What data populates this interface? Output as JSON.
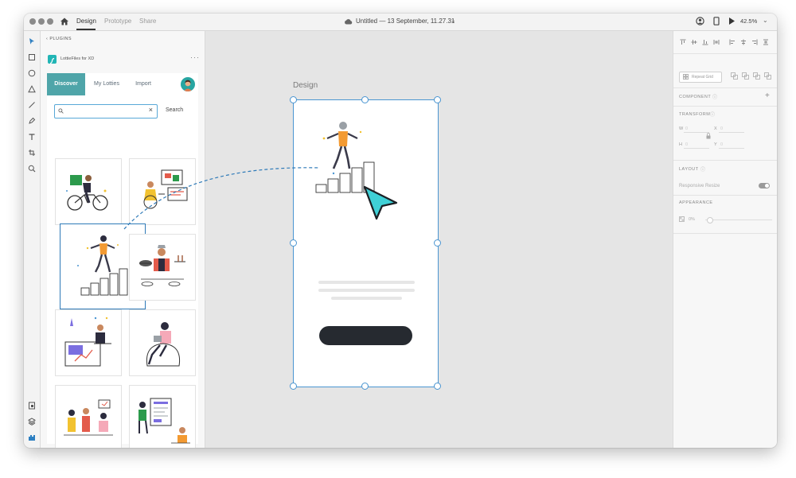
{
  "titlebar": {
    "tabs": [
      {
        "label": "Design",
        "active": true
      },
      {
        "label": "Prototype",
        "active": false
      },
      {
        "label": "Share",
        "active": false
      }
    ],
    "document_title": "Untitled — 13 September, 11.27.31",
    "zoom": "42.5%"
  },
  "plugins": {
    "back_label": "PLUGINS",
    "plugin_name": "LottieFiles for XD",
    "tabs": [
      {
        "label": "Discover",
        "active": true
      },
      {
        "label": "My Lotties",
        "active": false
      },
      {
        "label": "Import",
        "active": false
      }
    ],
    "search": {
      "value": "",
      "placeholder": "",
      "button_label": "Search"
    },
    "brand_color": "#4fa5a9"
  },
  "canvas": {
    "artboard_label": "Design",
    "selection_color": "#4a95d1",
    "cursor_color": "#3fd0d6"
  },
  "properties": {
    "repeat_grid": "Repeat Grid",
    "component": "COMPONENT",
    "transform": "TRANSFORM",
    "w_label": "W",
    "w_value": "0",
    "x_label": "X",
    "x_value": "0",
    "h_label": "H",
    "h_value": "0",
    "y_label": "Y",
    "y_value": "0",
    "layout": "LAYOUT",
    "responsive_resize": "Responsive Resize",
    "appearance": "APPEARANCE",
    "opacity": "0%"
  }
}
